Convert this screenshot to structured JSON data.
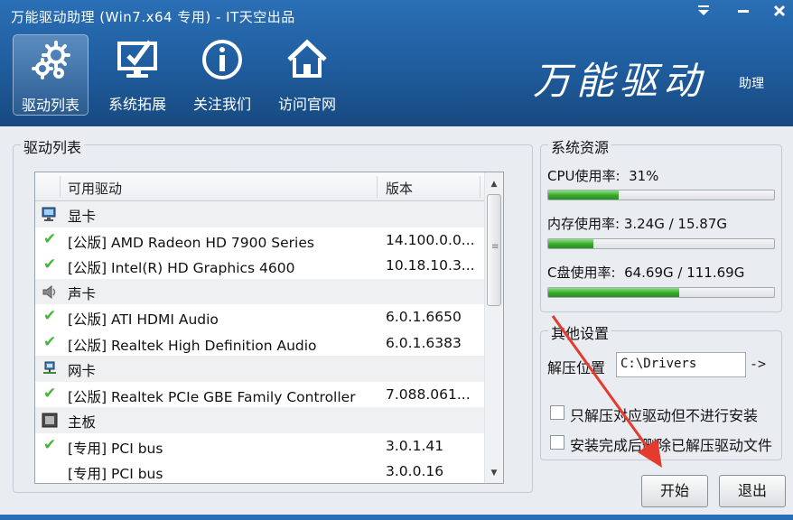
{
  "window": {
    "title": "万能驱动助理  (Win7.x64 专用) - IT天空出品",
    "controls": [
      "menu-icon",
      "minimize-icon",
      "close-icon"
    ]
  },
  "nav": [
    {
      "label": "驱动列表",
      "icon": "gears-icon",
      "active": true
    },
    {
      "label": "系统拓展",
      "icon": "monitor-check-icon",
      "active": false
    },
    {
      "label": "关注我们",
      "icon": "info-icon",
      "active": false
    },
    {
      "label": "访问官网",
      "icon": "home-icon",
      "active": false
    }
  ],
  "brand": {
    "main": "万能驱动",
    "sub": "助理"
  },
  "driver_list": {
    "group_title": "驱动列表",
    "columns": [
      "可用驱动",
      "版本"
    ],
    "rows": [
      {
        "type": "category",
        "icon": "display-adapter-icon",
        "name": "显卡"
      },
      {
        "type": "driver",
        "name": "[公版] AMD Radeon HD 7900 Series",
        "version": "14.100.0.0..."
      },
      {
        "type": "driver",
        "name": "[公版] Intel(R) HD Graphics 4600",
        "version": "10.18.10.3..."
      },
      {
        "type": "category",
        "icon": "speaker-icon",
        "name": "声卡"
      },
      {
        "type": "driver",
        "name": "[公版] ATI HDMI Audio",
        "version": "6.0.1.6650"
      },
      {
        "type": "driver",
        "name": "[公版] Realtek High Definition Audio",
        "version": "6.0.1.6383"
      },
      {
        "type": "category",
        "icon": "network-icon",
        "name": "网卡"
      },
      {
        "type": "driver",
        "name": "[公版] Realtek PCIe GBE Family Controller",
        "version": "7.088.061..."
      },
      {
        "type": "category",
        "icon": "motherboard-icon",
        "name": "主板"
      },
      {
        "type": "driver",
        "name": "[专用] PCI bus",
        "version": "3.0.1.41"
      },
      {
        "type": "driver",
        "name": "[专用] PCI bus",
        "version": "3.0.0.16",
        "checked": false
      }
    ]
  },
  "resources": {
    "group_title": "系统资源",
    "cpu": {
      "label": "CPU使用率:  31%",
      "fraction": 0.31
    },
    "mem": {
      "label": "内存使用率: 3.24G / 15.87G",
      "fraction": 0.2
    },
    "disk": {
      "label": "C盘使用率:  64.69G / 111.69G",
      "fraction": 0.58
    }
  },
  "settings": {
    "group_title": "其他设置",
    "extract_label": "解压位置",
    "extract_path": "C:\\Drivers",
    "arrow_label": "->",
    "option1": "只解压对应驱动但不进行安装",
    "option2": "安装完成后删除已解压驱动文件"
  },
  "buttons": {
    "start": "开始",
    "exit": "退出"
  },
  "colors": {
    "header": "#1f5c9d",
    "progress": "#36a82a",
    "check": "#49b43c",
    "annotation_arrow": "#e53a2e"
  }
}
